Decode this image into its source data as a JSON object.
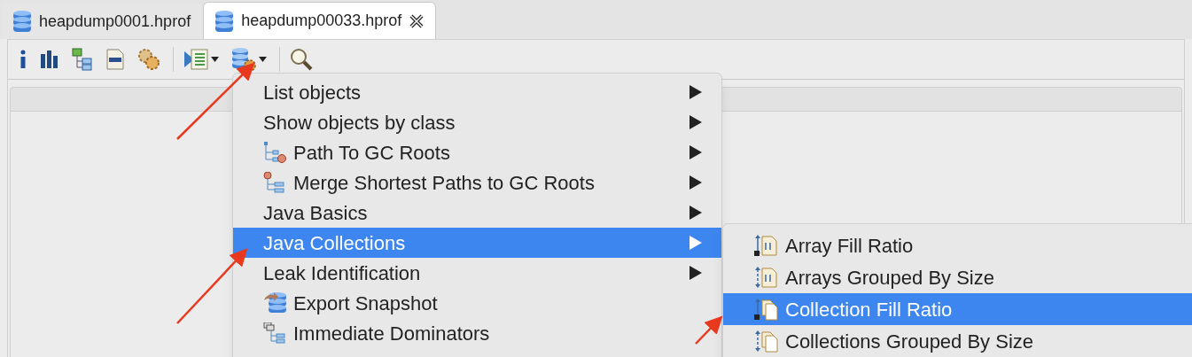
{
  "tabs": [
    {
      "label": "heapdump0001.hprof",
      "selected": false
    },
    {
      "label": "heapdump00033.hprof",
      "selected": true
    }
  ],
  "toolbar": {
    "buttons": [
      {
        "kind": "info"
      },
      {
        "kind": "histogram"
      },
      {
        "kind": "tree"
      },
      {
        "kind": "oql"
      },
      {
        "kind": "gears"
      },
      {
        "kind": "run"
      },
      {
        "kind": "query"
      },
      {
        "kind": "search"
      }
    ]
  },
  "menu": {
    "items": [
      {
        "label": "List objects",
        "has_submenu": true,
        "selected": false
      },
      {
        "label": "Show objects by class",
        "has_submenu": true,
        "selected": false
      },
      {
        "label": "Path To GC Roots",
        "has_submenu": true,
        "selected": false
      },
      {
        "label": "Merge Shortest Paths to GC Roots",
        "has_submenu": true,
        "selected": false
      },
      {
        "label": "Java Basics",
        "has_submenu": true,
        "selected": false
      },
      {
        "label": "Java Collections",
        "has_submenu": true,
        "selected": true
      },
      {
        "label": "Leak Identification",
        "has_submenu": true,
        "selected": false
      },
      {
        "label": "Export Snapshot",
        "has_submenu": false,
        "selected": false
      },
      {
        "label": "Immediate Dominators",
        "has_submenu": false,
        "selected": false
      }
    ]
  },
  "submenu": {
    "items": [
      {
        "label": "Array Fill Ratio",
        "selected": false
      },
      {
        "label": "Arrays Grouped By Size",
        "selected": false
      },
      {
        "label": "Collection Fill Ratio",
        "selected": true
      },
      {
        "label": "Collections Grouped By Size",
        "selected": false
      }
    ]
  }
}
